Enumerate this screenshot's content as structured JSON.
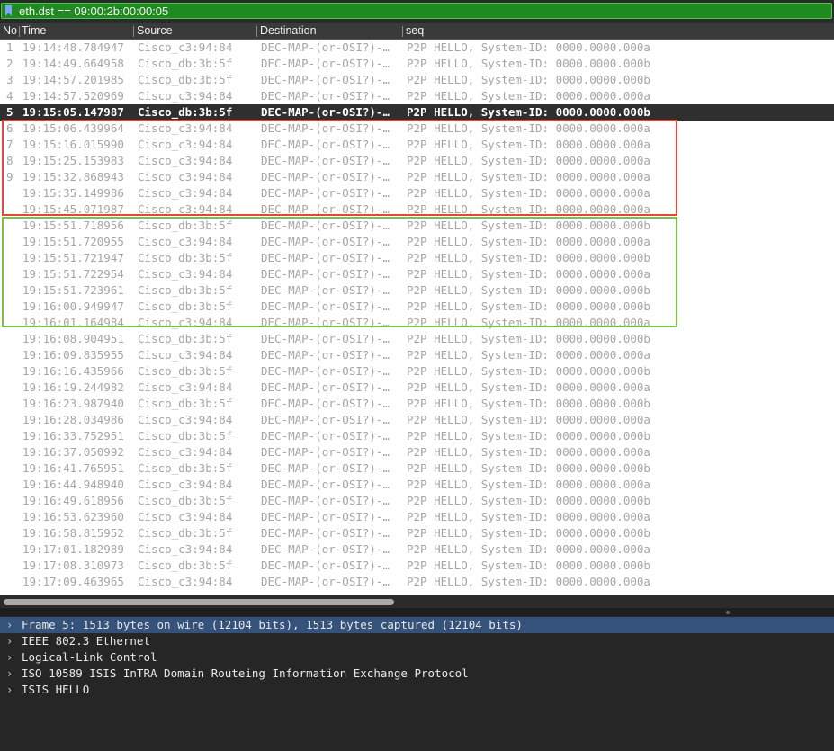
{
  "filter": {
    "icon": "bookmark-icon",
    "value": "eth.dst == 09:00:2b:00:00:05"
  },
  "columns": {
    "no": "No",
    "time": "Time",
    "source": "Source",
    "destination": "Destination",
    "info": "seq"
  },
  "packets": [
    {
      "no": "1",
      "time": "19:14:48.784947",
      "src": "Cisco_c3:94:84",
      "dst": "DEC-MAP-(or-OSI?)-…",
      "info": "P2P HELLO, System-ID: 0000.0000.000a"
    },
    {
      "no": "2",
      "time": "19:14:49.664958",
      "src": "Cisco_db:3b:5f",
      "dst": "DEC-MAP-(or-OSI?)-…",
      "info": "P2P HELLO, System-ID: 0000.0000.000b"
    },
    {
      "no": "3",
      "time": "19:14:57.201985",
      "src": "Cisco_db:3b:5f",
      "dst": "DEC-MAP-(or-OSI?)-…",
      "info": "P2P HELLO, System-ID: 0000.0000.000b"
    },
    {
      "no": "4",
      "time": "19:14:57.520969",
      "src": "Cisco_c3:94:84",
      "dst": "DEC-MAP-(or-OSI?)-…",
      "info": "P2P HELLO, System-ID: 0000.0000.000a"
    },
    {
      "no": "5",
      "time": "19:15:05.147987",
      "src": "Cisco_db:3b:5f",
      "dst": "DEC-MAP-(or-OSI?)-…",
      "info": "P2P HELLO, System-ID: 0000.0000.000b",
      "selected": true
    },
    {
      "no": "6",
      "time": "19:15:06.439964",
      "src": "Cisco_c3:94:84",
      "dst": "DEC-MAP-(or-OSI?)-…",
      "info": "P2P HELLO, System-ID: 0000.0000.000a"
    },
    {
      "no": "7",
      "time": "19:15:16.015990",
      "src": "Cisco_c3:94:84",
      "dst": "DEC-MAP-(or-OSI?)-…",
      "info": "P2P HELLO, System-ID: 0000.0000.000a"
    },
    {
      "no": "8",
      "time": "19:15:25.153983",
      "src": "Cisco_c3:94:84",
      "dst": "DEC-MAP-(or-OSI?)-…",
      "info": "P2P HELLO, System-ID: 0000.0000.000a"
    },
    {
      "no": "9",
      "time": "19:15:32.868943",
      "src": "Cisco_c3:94:84",
      "dst": "DEC-MAP-(or-OSI?)-…",
      "info": "P2P HELLO, System-ID: 0000.0000.000a"
    },
    {
      "no": "",
      "time": "19:15:35.149986",
      "src": "Cisco_c3:94:84",
      "dst": "DEC-MAP-(or-OSI?)-…",
      "info": "P2P HELLO, System-ID: 0000.0000.000a"
    },
    {
      "no": "",
      "time": "19:15:45.071987",
      "src": "Cisco_c3:94:84",
      "dst": "DEC-MAP-(or-OSI?)-…",
      "info": "P2P HELLO, System-ID: 0000.0000.000a"
    },
    {
      "no": "",
      "time": "19:15:51.718956",
      "src": "Cisco_db:3b:5f",
      "dst": "DEC-MAP-(or-OSI?)-…",
      "info": "P2P HELLO, System-ID: 0000.0000.000b"
    },
    {
      "no": "",
      "time": "19:15:51.720955",
      "src": "Cisco_c3:94:84",
      "dst": "DEC-MAP-(or-OSI?)-…",
      "info": "P2P HELLO, System-ID: 0000.0000.000a"
    },
    {
      "no": "",
      "time": "19:15:51.721947",
      "src": "Cisco_db:3b:5f",
      "dst": "DEC-MAP-(or-OSI?)-…",
      "info": "P2P HELLO, System-ID: 0000.0000.000b"
    },
    {
      "no": "",
      "time": "19:15:51.722954",
      "src": "Cisco_c3:94:84",
      "dst": "DEC-MAP-(or-OSI?)-…",
      "info": "P2P HELLO, System-ID: 0000.0000.000a"
    },
    {
      "no": "",
      "time": "19:15:51.723961",
      "src": "Cisco_db:3b:5f",
      "dst": "DEC-MAP-(or-OSI?)-…",
      "info": "P2P HELLO, System-ID: 0000.0000.000b"
    },
    {
      "no": "",
      "time": "19:16:00.949947",
      "src": "Cisco_db:3b:5f",
      "dst": "DEC-MAP-(or-OSI?)-…",
      "info": "P2P HELLO, System-ID: 0000.0000.000b"
    },
    {
      "no": "",
      "time": "19:16:01.164984",
      "src": "Cisco_c3:94:84",
      "dst": "DEC-MAP-(or-OSI?)-…",
      "info": "P2P HELLO, System-ID: 0000.0000.000a"
    },
    {
      "no": "",
      "time": "19:16:08.904951",
      "src": "Cisco_db:3b:5f",
      "dst": "DEC-MAP-(or-OSI?)-…",
      "info": "P2P HELLO, System-ID: 0000.0000.000b"
    },
    {
      "no": "",
      "time": "19:16:09.835955",
      "src": "Cisco_c3:94:84",
      "dst": "DEC-MAP-(or-OSI?)-…",
      "info": "P2P HELLO, System-ID: 0000.0000.000a"
    },
    {
      "no": "",
      "time": "19:16:16.435966",
      "src": "Cisco_db:3b:5f",
      "dst": "DEC-MAP-(or-OSI?)-…",
      "info": "P2P HELLO, System-ID: 0000.0000.000b"
    },
    {
      "no": "",
      "time": "19:16:19.244982",
      "src": "Cisco_c3:94:84",
      "dst": "DEC-MAP-(or-OSI?)-…",
      "info": "P2P HELLO, System-ID: 0000.0000.000a"
    },
    {
      "no": "",
      "time": "19:16:23.987940",
      "src": "Cisco_db:3b:5f",
      "dst": "DEC-MAP-(or-OSI?)-…",
      "info": "P2P HELLO, System-ID: 0000.0000.000b"
    },
    {
      "no": "",
      "time": "19:16:28.034986",
      "src": "Cisco_c3:94:84",
      "dst": "DEC-MAP-(or-OSI?)-…",
      "info": "P2P HELLO, System-ID: 0000.0000.000a"
    },
    {
      "no": "",
      "time": "19:16:33.752951",
      "src": "Cisco_db:3b:5f",
      "dst": "DEC-MAP-(or-OSI?)-…",
      "info": "P2P HELLO, System-ID: 0000.0000.000b"
    },
    {
      "no": "",
      "time": "19:16:37.050992",
      "src": "Cisco_c3:94:84",
      "dst": "DEC-MAP-(or-OSI?)-…",
      "info": "P2P HELLO, System-ID: 0000.0000.000a"
    },
    {
      "no": "",
      "time": "19:16:41.765951",
      "src": "Cisco_db:3b:5f",
      "dst": "DEC-MAP-(or-OSI?)-…",
      "info": "P2P HELLO, System-ID: 0000.0000.000b"
    },
    {
      "no": "",
      "time": "19:16:44.948940",
      "src": "Cisco_c3:94:84",
      "dst": "DEC-MAP-(or-OSI?)-…",
      "info": "P2P HELLO, System-ID: 0000.0000.000a"
    },
    {
      "no": "",
      "time": "19:16:49.618956",
      "src": "Cisco_db:3b:5f",
      "dst": "DEC-MAP-(or-OSI?)-…",
      "info": "P2P HELLO, System-ID: 0000.0000.000b"
    },
    {
      "no": "",
      "time": "19:16:53.623960",
      "src": "Cisco_c3:94:84",
      "dst": "DEC-MAP-(or-OSI?)-…",
      "info": "P2P HELLO, System-ID: 0000.0000.000a"
    },
    {
      "no": "",
      "time": "19:16:58.815952",
      "src": "Cisco_db:3b:5f",
      "dst": "DEC-MAP-(or-OSI?)-…",
      "info": "P2P HELLO, System-ID: 0000.0000.000b"
    },
    {
      "no": "",
      "time": "19:17:01.182989",
      "src": "Cisco_c3:94:84",
      "dst": "DEC-MAP-(or-OSI?)-…",
      "info": "P2P HELLO, System-ID: 0000.0000.000a"
    },
    {
      "no": "",
      "time": "19:17:08.310973",
      "src": "Cisco_db:3b:5f",
      "dst": "DEC-MAP-(or-OSI?)-…",
      "info": "P2P HELLO, System-ID: 0000.0000.000b"
    },
    {
      "no": "",
      "time": "19:17:09.463965",
      "src": "Cisco_c3:94:84",
      "dst": "DEC-MAP-(or-OSI?)-…",
      "info": "P2P HELLO, System-ID: 0000.0000.000a"
    }
  ],
  "colors": {
    "highlight_red": "#e2463c",
    "highlight_green": "#7cc242",
    "filter_bg": "#1f8a1f",
    "selected_detail": "#34527a"
  },
  "details": [
    {
      "icon": "chevron-right-icon",
      "text": "Frame 5: 1513 bytes on wire (12104 bits), 1513 bytes captured (12104 bits)",
      "selected": true
    },
    {
      "icon": "chevron-right-icon",
      "text": "IEEE 802.3 Ethernet"
    },
    {
      "icon": "chevron-right-icon",
      "text": "Logical-Link Control"
    },
    {
      "icon": "chevron-right-icon",
      "text": "ISO 10589 ISIS InTRA Domain Routeing Information Exchange Protocol"
    },
    {
      "icon": "chevron-right-icon",
      "text": "ISIS HELLO"
    }
  ]
}
